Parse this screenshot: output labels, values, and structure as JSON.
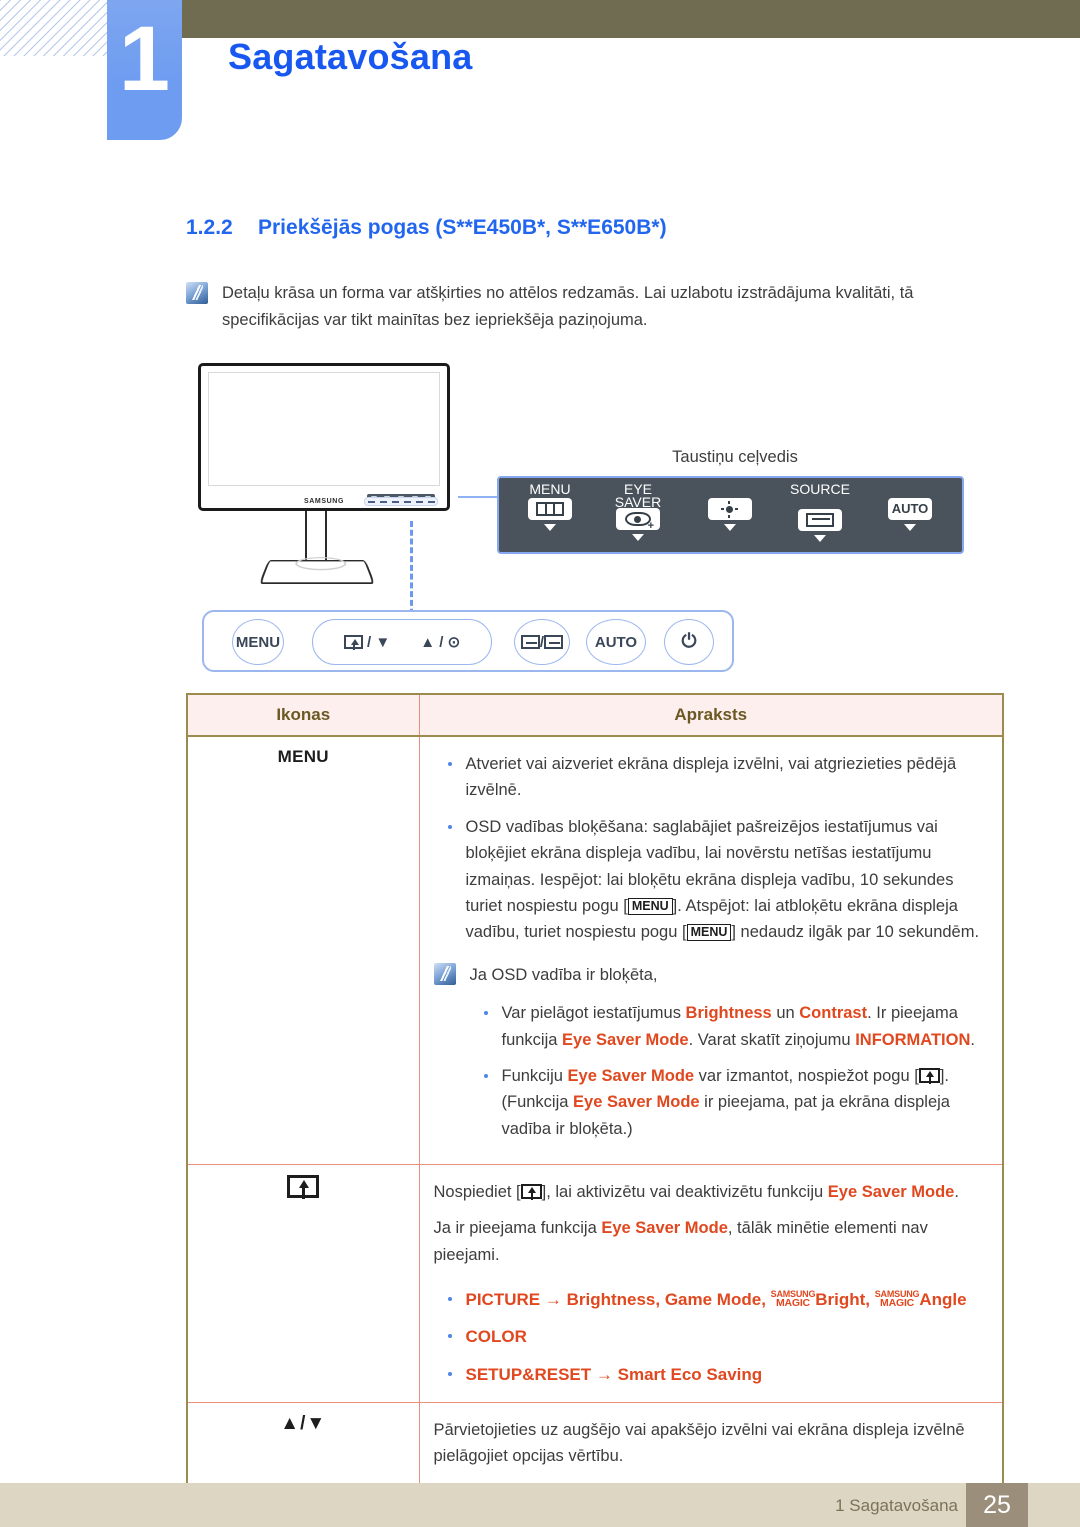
{
  "header": {
    "chapter_number": "1",
    "chapter_title": "Sagatavošana"
  },
  "section": {
    "number": "1.2.2",
    "title": "Priekšējās pogas (S**E450B*, S**E650B*)"
  },
  "note": {
    "icon": "note-pencil-icon",
    "text": "Detaļu krāsa un forma var atšķirties no attēlos redzamās. Lai uzlabotu izstrādājuma kvalitāti, tā specifikācijas var tikt mainītas bez iepriekšēja paziņojuma."
  },
  "illustration": {
    "monitor_brand": "SAMSUNG",
    "key_guide_label": "Taustiņu ceļvedis",
    "key_guide_buttons": [
      {
        "caption": "MENU",
        "icon": "menu-bars-icon"
      },
      {
        "caption": "EYE\nSAVER",
        "icon": "eye-plus-icon"
      },
      {
        "caption": "",
        "icon": "brightness-icon"
      },
      {
        "caption": "SOURCE",
        "icon": "source-icon"
      },
      {
        "caption": "",
        "icon": "auto-text-icon",
        "text": "AUTO"
      }
    ],
    "front_buttons": [
      {
        "label": "MENU",
        "icon": "menu-text-button"
      },
      {
        "label": "/",
        "icon": "eyesaver-down-button",
        "suffix": "▼"
      },
      {
        "label": "/",
        "icon": "up-enter-button",
        "prefix": "▲",
        "suffix": "⊙"
      },
      {
        "label": "/",
        "icon": "source-return-button"
      },
      {
        "label": "AUTO",
        "icon": "auto-button"
      },
      {
        "label": "⏻",
        "icon": "power-button"
      }
    ]
  },
  "table": {
    "headers": [
      "Ikonas",
      "Apraksts"
    ],
    "rows": [
      {
        "icon_label": "MENU",
        "icon_name": "menu-icon",
        "bullets": [
          "Atveriet vai aizveriet ekrāna displeja izvēlni, vai atgriezieties pēdējā izvēlnē.",
          "OSD vadības bloķēšana: saglabājiet pašreizējos iestatījumus vai bloķējiet ekrāna displeja vadību, lai novērstu netīšas iestatījumu izmaiņas. Iespējot: lai bloķētu ekrāna displeja vadību, 10 sekundes turiet nospiestu pogu [MENU]. Atspējot: lai atbloķētu ekrāna displeja vadību, turiet nospiestu pogu [MENU] nedaudz ilgāk par 10 sekundēm."
        ],
        "bullet2_parts": {
          "p1": "OSD vadības bloķēšana: saglabājiet pašreizējos iestatījumus vai bloķējiet ekrāna displeja vadību, lai novērstu netīšas iestatījumu izmaiņas. Iespējot: lai bloķētu ekrāna displeja vadību, 10 sekundes turiet nospiestu pogu [",
          "kbd1": "MENU",
          "p2": "]. Atspējot: lai atbloķētu ekrāna displeja vadību, turiet nospiestu pogu [",
          "kbd2": "MENU",
          "p3": "] nedaudz ilgāk par 10 sekundēm."
        },
        "subnote": {
          "lead": "Ja OSD vadība ir bloķēta,",
          "bullets": [
            {
              "s1": "Var pielāgot iestatījumus ",
              "kw1": "Brightness",
              "s2": " un ",
              "kw2": "Contrast",
              "s3": ". Ir pieejama funkcija ",
              "kw3": "Eye Saver Mode",
              "s4": ". Varat skatīt ziņojumu ",
              "kw4": "INFORMATION",
              "s5": "."
            },
            {
              "s1": "Funkciju ",
              "kw1": "Eye Saver Mode",
              "s2": " var izmantot, nospiežot pogu [",
              "s3": "]. (Funkcija ",
              "kw2": "Eye Saver Mode",
              "s4": " ir pieejama, pat ja ekrāna displeja vadība ir bloķēta.)"
            }
          ]
        }
      },
      {
        "icon_name": "eye-saver-icon",
        "line1": {
          "s1": "Nospiediet [",
          "s2": "], lai aktivizētu vai deaktivizētu funkciju ",
          "kw1": "Eye Saver Mode",
          "s3": "."
        },
        "line2": {
          "s1": "Ja ir pieejama funkcija ",
          "kw1": "Eye Saver Mode",
          "s2": ", tālāk minētie elementi nav pieejami."
        },
        "menu_bullets": [
          {
            "head": "PICTURE",
            "arrow": "→",
            "items": "Brightness, Game Mode, ",
            "magic1_sup": "SAMSUNG",
            "magic1_main": "MAGIC",
            "magic1_word": "Bright",
            "sep": ", ",
            "magic2_sup": "SAMSUNG",
            "magic2_main": "MAGIC",
            "magic2_word": "Angle"
          },
          {
            "head": "COLOR"
          },
          {
            "head": "SETUP&RESET",
            "arrow": "→",
            "items": "Smart Eco Saving"
          }
        ]
      },
      {
        "icon_label": "▲/▼",
        "icon_name": "up-down-arrows-icon",
        "text": "Pārvietojieties uz augšējo vai apakšējo izvēlni vai ekrāna displeja izvēlnē pielāgojiet opcijas vērtību."
      }
    ]
  },
  "footer": {
    "text": "1 Sagatavošana",
    "page_number": "25"
  },
  "colors": {
    "chapter_blue": "#6e9cf0",
    "title_blue": "#1858f0",
    "header_olive": "#6f6c52",
    "keyword_red": "#e0481f",
    "table_border": "#9c8b4f",
    "table_inner": "#e8907a",
    "footer_bg": "#ddd6c3",
    "page_badge": "#9b8f7c"
  }
}
